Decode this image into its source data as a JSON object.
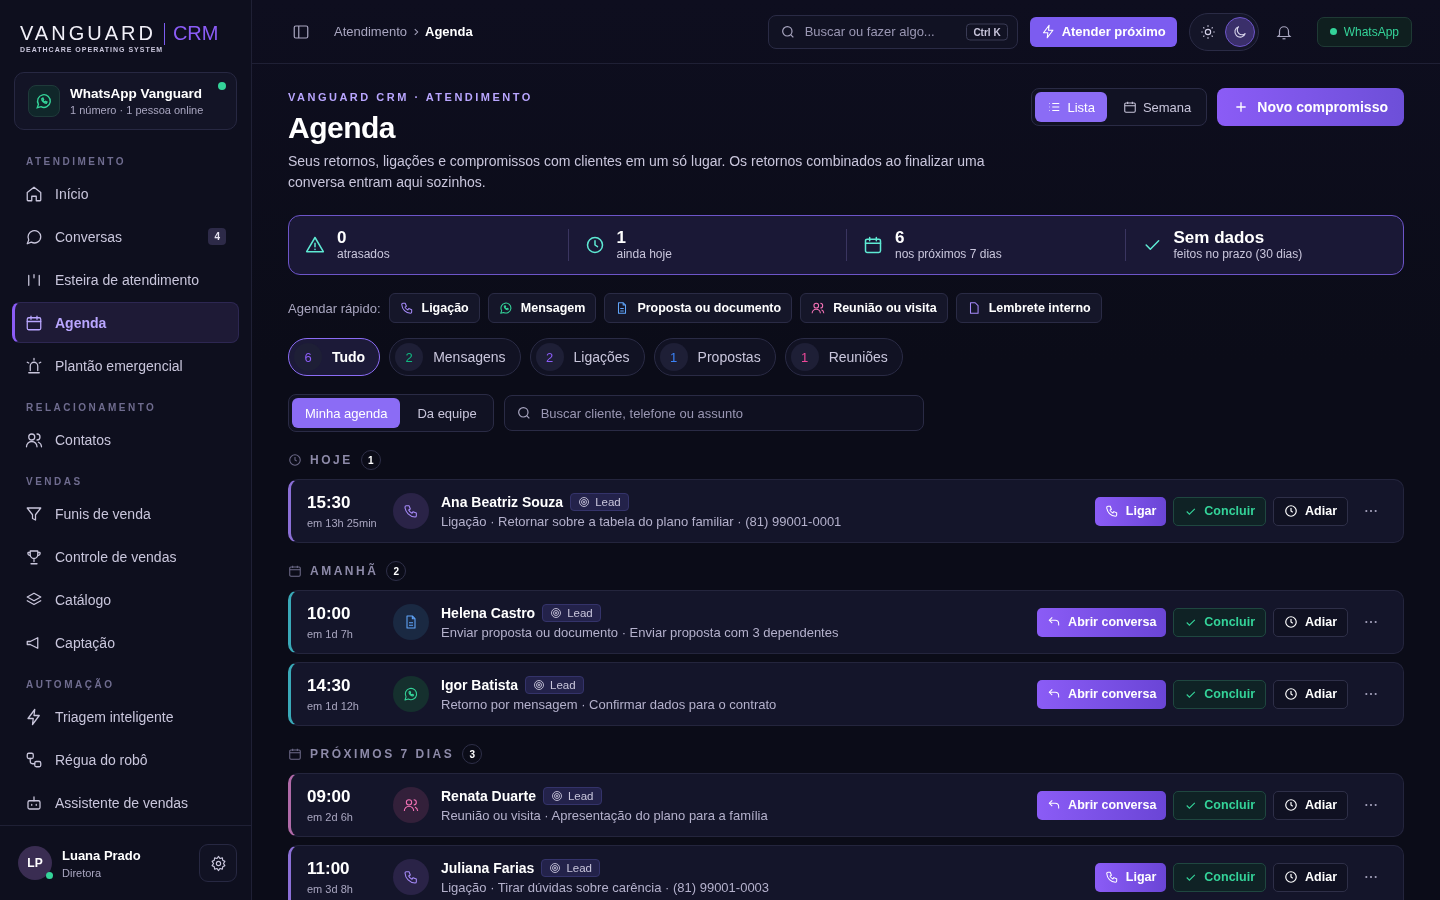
{
  "brand": {
    "name": "VANGUARD",
    "product": "CRM",
    "tagline": "DEATHCARE OPERATING SYSTEM"
  },
  "whatsapp_card": {
    "title": "WhatsApp Vanguard",
    "subtitle": "1 número · 1 pessoa online",
    "online": true
  },
  "sidebar": {
    "sections": [
      {
        "title": "ATENDIMENTO",
        "items": [
          {
            "label": "Início",
            "selected": false
          },
          {
            "label": "Conversas",
            "selected": false,
            "badge": "4"
          },
          {
            "label": "Esteira de atendimento",
            "selected": false
          },
          {
            "label": "Agenda",
            "selected": true
          },
          {
            "label": "Plantão emergencial",
            "selected": false
          }
        ]
      },
      {
        "title": "RELACIONAMENTO",
        "items": [
          {
            "label": "Contatos",
            "selected": false
          }
        ]
      },
      {
        "title": "VENDAS",
        "items": [
          {
            "label": "Funis de venda",
            "selected": false
          },
          {
            "label": "Controle de vendas",
            "selected": false
          },
          {
            "label": "Catálogo",
            "selected": false
          },
          {
            "label": "Captação",
            "selected": false
          }
        ]
      },
      {
        "title": "AUTOMAÇÃO",
        "items": [
          {
            "label": "Triagem inteligente",
            "selected": false
          },
          {
            "label": "Régua do robô",
            "selected": false
          },
          {
            "label": "Assistente de vendas",
            "selected": false
          }
        ]
      }
    ]
  },
  "user": {
    "initials": "LP",
    "name": "Luana Prado",
    "role": "Diretora",
    "online": true
  },
  "breadcrumb": [
    "Atendimento",
    "Agenda"
  ],
  "global_search": {
    "placeholder": "Buscar ou fazer algo...",
    "shortcut": "Ctrl K"
  },
  "attend_button": "Atender próximo",
  "theme_toggle": [
    {
      "selected": false
    },
    {
      "selected": true
    }
  ],
  "whatsapp_status": {
    "label": "WhatsApp",
    "connected": true
  },
  "eyebrow": "VANGUARD CRM · ATENDIMENTO",
  "title": "Agenda",
  "description": "Seus retornos, ligações e compromissos com clientes em um só lugar. Os retornos combinados ao finalizar uma conversa entram aqui sozinhos.",
  "view_toggle": [
    {
      "label": "Lista",
      "selected": true
    },
    {
      "label": "Semana",
      "selected": false
    }
  ],
  "new_button": "Novo compromisso",
  "stats": [
    {
      "value": "0",
      "label": "atrasados"
    },
    {
      "value": "1",
      "label": "ainda hoje"
    },
    {
      "value": "6",
      "label": "nos próximos 7 dias"
    },
    {
      "value": "Sem dados",
      "label": "feitos no prazo (30 dias)"
    }
  ],
  "quick_label": "Agendar rápido:",
  "quick_actions": [
    {
      "label": "Ligação",
      "kind": "call"
    },
    {
      "label": "Mensagem",
      "kind": "message"
    },
    {
      "label": "Proposta ou documento",
      "kind": "proposal"
    },
    {
      "label": "Reunião ou visita",
      "kind": "meeting"
    },
    {
      "label": "Lembrete interno",
      "kind": "note"
    }
  ],
  "filters": [
    {
      "count": "6",
      "label": "Tudo",
      "selected": true,
      "color": "#8b5cf6"
    },
    {
      "count": "2",
      "label": "Mensagens",
      "selected": false,
      "color": "#10b981"
    },
    {
      "count": "2",
      "label": "Ligações",
      "selected": false,
      "color": "#8b5cf6"
    },
    {
      "count": "1",
      "label": "Propostas",
      "selected": false,
      "color": "#3b82f6"
    },
    {
      "count": "1",
      "label": "Reuniões",
      "selected": false,
      "color": "#ec4899"
    }
  ],
  "scope": [
    {
      "label": "Minha agenda",
      "selected": true
    },
    {
      "label": "Da equipe",
      "selected": false
    }
  ],
  "list_search": {
    "placeholder": "Buscar cliente, telefone ou assunto"
  },
  "groups": [
    {
      "label": "HOJE",
      "count": "1",
      "items": [
        {
          "time": "15:30",
          "relative": "em 13h 25min",
          "name": "Ana Beatriz Souza",
          "tag": "Lead",
          "kind": "call",
          "description": "Ligação · Retornar sobre a tabela do plano familiar · (81) 99001-0001",
          "primary": "Ligar",
          "done": "Concluir",
          "postpone": "Adiar"
        }
      ]
    },
    {
      "label": "AMANHÃ",
      "count": "2",
      "items": [
        {
          "time": "10:00",
          "relative": "em 1d 7h",
          "name": "Helena Castro",
          "tag": "Lead",
          "kind": "proposal",
          "description": "Enviar proposta ou documento · Enviar proposta com 3 dependentes",
          "primary": "Abrir conversa",
          "done": "Concluir",
          "postpone": "Adiar"
        },
        {
          "time": "14:30",
          "relative": "em 1d 12h",
          "name": "Igor Batista",
          "tag": "Lead",
          "kind": "message",
          "description": "Retorno por mensagem · Confirmar dados para o contrato",
          "primary": "Abrir conversa",
          "done": "Concluir",
          "postpone": "Adiar"
        }
      ]
    },
    {
      "label": "PRÓXIMOS 7 DIAS",
      "count": "3",
      "items": [
        {
          "time": "09:00",
          "relative": "em 2d 6h",
          "name": "Renata Duarte",
          "tag": "Lead",
          "kind": "meeting",
          "description": "Reunião ou visita · Apresentação do plano para a família",
          "primary": "Abrir conversa",
          "done": "Concluir",
          "postpone": "Adiar"
        },
        {
          "time": "11:00",
          "relative": "em 3d 8h",
          "name": "Juliana Farias",
          "tag": "Lead",
          "kind": "call",
          "description": "Ligação · Tirar dúvidas sobre carência · (81) 99001-0003",
          "primary": "Ligar",
          "done": "Concluir",
          "postpone": "Adiar"
        }
      ]
    }
  ]
}
